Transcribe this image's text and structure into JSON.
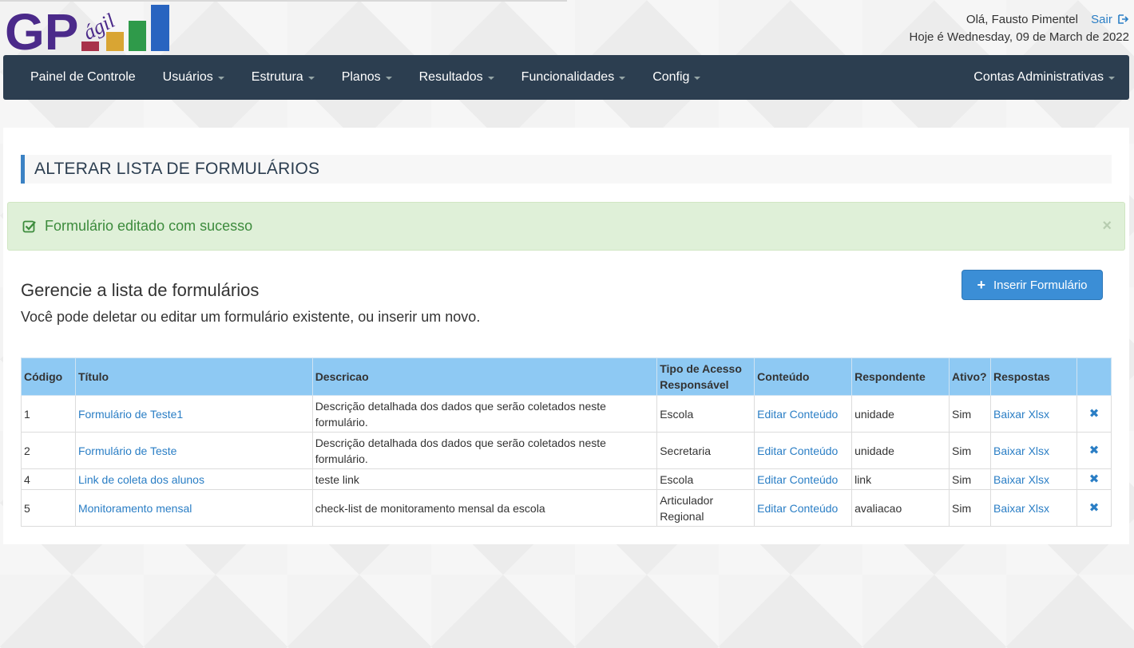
{
  "header": {
    "logo_text": "GP",
    "logo_sub": "ágil",
    "greeting": "Olá, Fausto Pimentel",
    "logout_label": "Sair",
    "today_text": "Hoje é Wednesday, 09 de March de 2022"
  },
  "navbar": {
    "items": [
      {
        "label": "Painel de Controle",
        "dropdown": false
      },
      {
        "label": "Usuários",
        "dropdown": true
      },
      {
        "label": "Estrutura",
        "dropdown": true
      },
      {
        "label": "Planos",
        "dropdown": true
      },
      {
        "label": "Resultados",
        "dropdown": true
      },
      {
        "label": "Funcionalidades",
        "dropdown": true
      },
      {
        "label": "Config",
        "dropdown": true
      }
    ],
    "right_item": "Contas Administrativas"
  },
  "page": {
    "title": "ALTERAR LISTA DE FORMULÁRIOS",
    "alert_message": "Formulário editado com sucesso",
    "alert_close": "×",
    "heading": "Gerencie a lista de formulários",
    "subheading": "Você pode deletar ou editar um formulário existente, ou inserir um novo.",
    "insert_button": "Inserir Formulário"
  },
  "table": {
    "headers": {
      "codigo": "Código",
      "titulo": "Título",
      "descricao": "Descricao",
      "tipo": "Tipo de Acesso Responsável",
      "conteudo": "Conteúdo",
      "respondente": "Respondente",
      "ativo": "Ativo?",
      "respostas": "Respostas"
    },
    "rows": [
      {
        "codigo": "1",
        "titulo": "Formulário de Teste1",
        "descricao": "Descrição detalhada dos dados que serão coletados neste formulário.",
        "tipo": "Escola",
        "conteudo": "Editar Conteúdo",
        "respondente": "unidade",
        "ativo": "Sim",
        "respostas": "Baixar Xlsx",
        "delete": "✖"
      },
      {
        "codigo": "2",
        "titulo": "Formulário de Teste",
        "descricao": "Descrição detalhada dos dados que serão coletados neste formulário.",
        "tipo": "Secretaria",
        "conteudo": "Editar Conteúdo",
        "respondente": "unidade",
        "ativo": "Sim",
        "respostas": "Baixar Xlsx",
        "delete": "✖"
      },
      {
        "codigo": "4",
        "titulo": "Link de coleta dos alunos",
        "descricao": "teste link",
        "tipo": "Escola",
        "conteudo": "Editar Conteúdo",
        "respondente": "link",
        "ativo": "Sim",
        "respostas": "Baixar Xlsx",
        "delete": "✖"
      },
      {
        "codigo": "5",
        "titulo": "Monitoramento mensal",
        "descricao": "check-list de monitoramento mensal da escola",
        "tipo": "Articulador Regional",
        "conteudo": "Editar Conteúdo",
        "respondente": "avaliacao",
        "ativo": "Sim",
        "respostas": "Baixar Xlsx",
        "delete": "✖"
      }
    ]
  },
  "colors": {
    "navbar_bg": "#2c3e50",
    "accent": "#3b8ed6",
    "link": "#2a7ec5",
    "table_header": "#8ec9f3",
    "alert_bg": "#dff0d8",
    "logo_purple": "#4b2a8a"
  },
  "icons": {
    "alert": "check-square-icon",
    "logout": "sign-out-icon",
    "insert": "plus-icon",
    "row_delete": "delete-x-icon"
  }
}
